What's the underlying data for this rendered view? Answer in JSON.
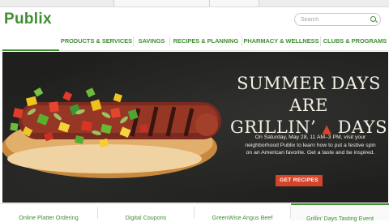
{
  "header": {
    "logo": "Publix",
    "search_placeholder": "Search"
  },
  "nav": {
    "items": [
      {
        "label": "PRODUCTS & SERVICES"
      },
      {
        "label": "SAVINGS"
      },
      {
        "label": "RECIPES & PLANNING"
      },
      {
        "label": "PHARMACY & WELLNESS"
      },
      {
        "label": "CLUBS & PROGRAMS"
      }
    ]
  },
  "hero": {
    "headline_line1": "SUMMER DAYS ARE",
    "headline_line2a": "GRILLIN’",
    "headline_line2b": "DAYS",
    "body": "On Saturday, May 28, 11 AM–3 PM, visit your neighborhood Publix to learn how to put a festive spin on an American favorite. Get a taste and be inspired.",
    "cta_label": "GET RECIPES"
  },
  "bottom_tabs": [
    {
      "label": "Online Platter Ordering"
    },
    {
      "label": "Digital Coupons"
    },
    {
      "label": "GreenWise Angus Beef"
    },
    {
      "label": "Grillin’ Days Tasting Event"
    }
  ],
  "colors": {
    "brand_green": "#3d8f2f",
    "cta_red": "#d4442a",
    "hero_bg": "#1f1f1e"
  }
}
